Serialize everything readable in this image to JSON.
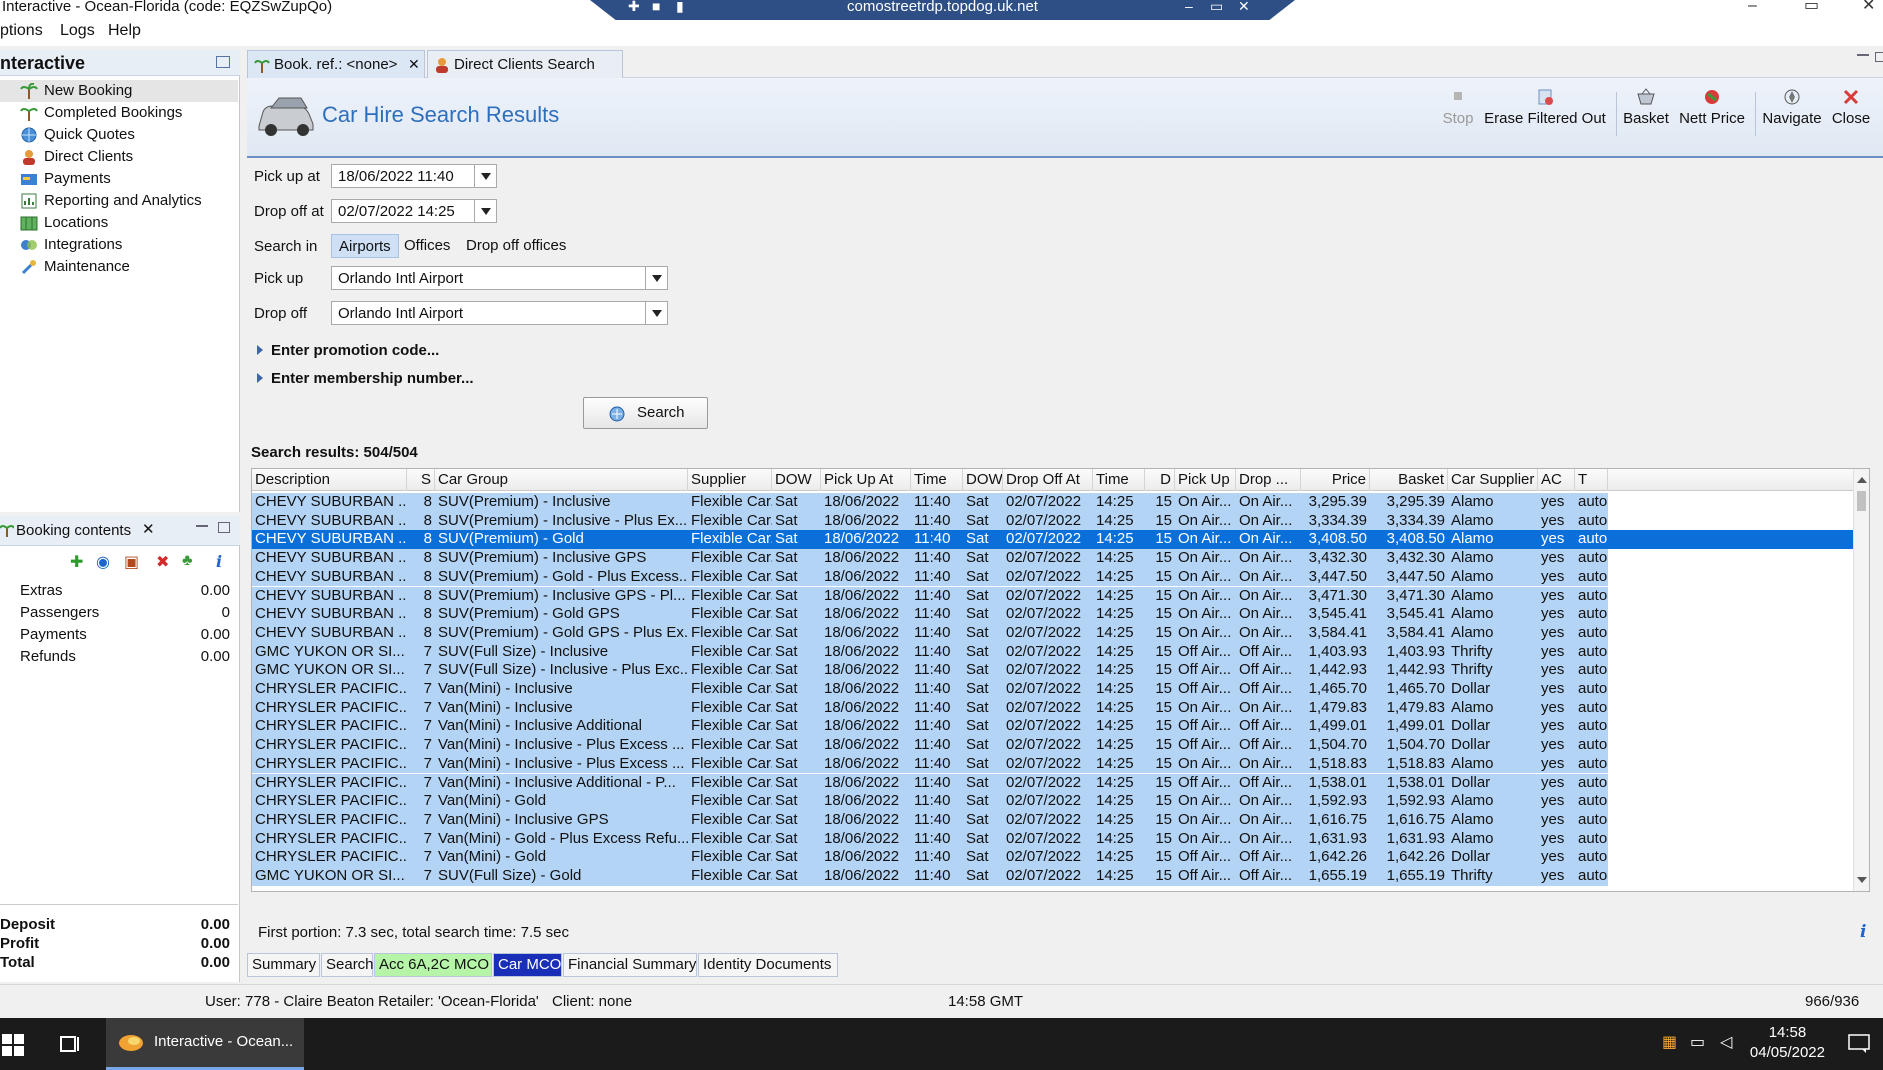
{
  "window": {
    "title": "Interactive - Ocean-Florida (code: EQZSwZupQo)",
    "rdp_host": "comostreetrdp.topdog.uk.net",
    "ctrl_min": "–",
    "ctrl_max": "▭",
    "ctrl_close": "✕"
  },
  "menu": [
    "ptions",
    "Logs",
    "Help"
  ],
  "leftnav": {
    "title": "nteractive",
    "items": [
      {
        "label": "New Booking",
        "icon": "palm-tree-icon"
      },
      {
        "label": "Completed Bookings",
        "icon": "palm-tree-icon"
      },
      {
        "label": "Quick Quotes",
        "icon": "globe-icon"
      },
      {
        "label": "Direct Clients",
        "icon": "person-icon"
      },
      {
        "label": "Payments",
        "icon": "payments-icon"
      },
      {
        "label": "Reporting and Analytics",
        "icon": "report-icon"
      },
      {
        "label": "Locations",
        "icon": "map-icon"
      },
      {
        "label": "Integrations",
        "icon": "integration-icon"
      },
      {
        "label": "Maintenance",
        "icon": "wrench-icon"
      }
    ]
  },
  "booking": {
    "title": "Booking contents",
    "close": "✕",
    "rows": [
      {
        "k": "Extras",
        "v": "0.00"
      },
      {
        "k": "Passengers",
        "v": "0"
      },
      {
        "k": "Payments",
        "v": "0.00"
      },
      {
        "k": "Refunds",
        "v": "0.00"
      }
    ],
    "totals": [
      {
        "k": "Deposit",
        "v": "0.00"
      },
      {
        "k": "Profit",
        "v": "0.00"
      },
      {
        "k": "Total",
        "v": "0.00"
      }
    ]
  },
  "tabs": [
    {
      "label": "Book. ref.: <none>"
    },
    {
      "label": "Direct Clients Search"
    }
  ],
  "tab_close": "✕",
  "header": {
    "title": "Car Hire Search Results",
    "tools": {
      "stop": "Stop",
      "erase": "Erase Filtered Out",
      "basket": "Basket",
      "nett": "Nett Price",
      "navigate": "Navigate",
      "close": "Close"
    }
  },
  "form": {
    "pickup_label": "Pick up at",
    "pickup_value": "18/06/2022 11:40",
    "dropoff_label": "Drop off at",
    "dropoff_value": "02/07/2022 14:25",
    "searchin_label": "Search in",
    "searchin_options": [
      "Airports",
      "Offices",
      "Drop off offices"
    ],
    "pickup_loc_label": "Pick up",
    "pickup_loc_value": "Orlando Intl Airport",
    "dropoff_loc_label": "Drop off",
    "dropoff_loc_value": "Orlando Intl Airport",
    "promo": "Enter promotion code...",
    "membership": "Enter membership number...",
    "search_button": "Search"
  },
  "results": {
    "count": "Search results: 504/504",
    "columns": [
      "Description",
      "S",
      "Car Group",
      "Supplier",
      "DOW",
      "Pick Up At",
      "Time",
      "DOW",
      "Drop Off At",
      "Time",
      "D",
      "Pick Up",
      "Drop ...",
      "Price",
      "Basket",
      "Car Supplier",
      "AC",
      "T"
    ],
    "rows": [
      [
        "CHEVY SUBURBAN ...",
        "8",
        "SUV(Premium) - Inclusive",
        "Flexible Car...",
        "Sat",
        "18/06/2022",
        "11:40",
        "Sat",
        "02/07/2022",
        "14:25",
        "15",
        "On Air...",
        "On Air...",
        "3,295.39",
        "3,295.39",
        "Alamo",
        "yes",
        "auto"
      ],
      [
        "CHEVY SUBURBAN ...",
        "8",
        "SUV(Premium) - Inclusive - Plus Ex...",
        "Flexible Car...",
        "Sat",
        "18/06/2022",
        "11:40",
        "Sat",
        "02/07/2022",
        "14:25",
        "15",
        "On Air...",
        "On Air...",
        "3,334.39",
        "3,334.39",
        "Alamo",
        "yes",
        "auto"
      ],
      [
        "CHEVY SUBURBAN ...",
        "8",
        "SUV(Premium) - Gold",
        "Flexible Car...",
        "Sat",
        "18/06/2022",
        "11:40",
        "Sat",
        "02/07/2022",
        "14:25",
        "15",
        "On Air...",
        "On Air...",
        "3,408.50",
        "3,408.50",
        "Alamo",
        "yes",
        "auto"
      ],
      [
        "CHEVY SUBURBAN ...",
        "8",
        "SUV(Premium) - Inclusive GPS",
        "Flexible Car...",
        "Sat",
        "18/06/2022",
        "11:40",
        "Sat",
        "02/07/2022",
        "14:25",
        "15",
        "On Air...",
        "On Air...",
        "3,432.30",
        "3,432.30",
        "Alamo",
        "yes",
        "auto"
      ],
      [
        "CHEVY SUBURBAN ...",
        "8",
        "SUV(Premium) - Gold - Plus Excess...",
        "Flexible Car...",
        "Sat",
        "18/06/2022",
        "11:40",
        "Sat",
        "02/07/2022",
        "14:25",
        "15",
        "On Air...",
        "On Air...",
        "3,447.50",
        "3,447.50",
        "Alamo",
        "yes",
        "auto"
      ],
      [
        "CHEVY SUBURBAN ...",
        "8",
        "SUV(Premium) - Inclusive GPS - Pl...",
        "Flexible Car...",
        "Sat",
        "18/06/2022",
        "11:40",
        "Sat",
        "02/07/2022",
        "14:25",
        "15",
        "On Air...",
        "On Air...",
        "3,471.30",
        "3,471.30",
        "Alamo",
        "yes",
        "auto"
      ],
      [
        "CHEVY SUBURBAN ...",
        "8",
        "SUV(Premium) - Gold GPS",
        "Flexible Car...",
        "Sat",
        "18/06/2022",
        "11:40",
        "Sat",
        "02/07/2022",
        "14:25",
        "15",
        "On Air...",
        "On Air...",
        "3,545.41",
        "3,545.41",
        "Alamo",
        "yes",
        "auto"
      ],
      [
        "CHEVY SUBURBAN ...",
        "8",
        "SUV(Premium) - Gold GPS - Plus Ex...",
        "Flexible Car...",
        "Sat",
        "18/06/2022",
        "11:40",
        "Sat",
        "02/07/2022",
        "14:25",
        "15",
        "On Air...",
        "On Air...",
        "3,584.41",
        "3,584.41",
        "Alamo",
        "yes",
        "auto"
      ],
      [
        "GMC YUKON OR SI...",
        "7",
        "SUV(Full Size) - Inclusive",
        "Flexible Car...",
        "Sat",
        "18/06/2022",
        "11:40",
        "Sat",
        "02/07/2022",
        "14:25",
        "15",
        "Off Air...",
        "Off Air...",
        "1,403.93",
        "1,403.93",
        "Thrifty",
        "yes",
        "auto"
      ],
      [
        "GMC YUKON OR SI...",
        "7",
        "SUV(Full Size) - Inclusive - Plus Exc...",
        "Flexible Car...",
        "Sat",
        "18/06/2022",
        "11:40",
        "Sat",
        "02/07/2022",
        "14:25",
        "15",
        "Off Air...",
        "Off Air...",
        "1,442.93",
        "1,442.93",
        "Thrifty",
        "yes",
        "auto"
      ],
      [
        "CHRYSLER PACIFIC...",
        "7",
        "Van(Mini) - Inclusive",
        "Flexible Car...",
        "Sat",
        "18/06/2022",
        "11:40",
        "Sat",
        "02/07/2022",
        "14:25",
        "15",
        "Off Air...",
        "Off Air...",
        "1,465.70",
        "1,465.70",
        "Dollar",
        "yes",
        "auto"
      ],
      [
        "CHRYSLER PACIFIC...",
        "7",
        "Van(Mini) - Inclusive",
        "Flexible Car...",
        "Sat",
        "18/06/2022",
        "11:40",
        "Sat",
        "02/07/2022",
        "14:25",
        "15",
        "On Air...",
        "On Air...",
        "1,479.83",
        "1,479.83",
        "Alamo",
        "yes",
        "auto"
      ],
      [
        "CHRYSLER PACIFIC...",
        "7",
        "Van(Mini) - Inclusive Additional",
        "Flexible Car...",
        "Sat",
        "18/06/2022",
        "11:40",
        "Sat",
        "02/07/2022",
        "14:25",
        "15",
        "Off Air...",
        "Off Air...",
        "1,499.01",
        "1,499.01",
        "Dollar",
        "yes",
        "auto"
      ],
      [
        "CHRYSLER PACIFIC...",
        "7",
        "Van(Mini) - Inclusive - Plus Excess ...",
        "Flexible Car...",
        "Sat",
        "18/06/2022",
        "11:40",
        "Sat",
        "02/07/2022",
        "14:25",
        "15",
        "Off Air...",
        "Off Air...",
        "1,504.70",
        "1,504.70",
        "Dollar",
        "yes",
        "auto"
      ],
      [
        "CHRYSLER PACIFIC...",
        "7",
        "Van(Mini) - Inclusive - Plus Excess ...",
        "Flexible Car...",
        "Sat",
        "18/06/2022",
        "11:40",
        "Sat",
        "02/07/2022",
        "14:25",
        "15",
        "On Air...",
        "On Air...",
        "1,518.83",
        "1,518.83",
        "Alamo",
        "yes",
        "auto"
      ],
      [
        "CHRYSLER PACIFIC...",
        "7",
        "Van(Mini) - Inclusive Additional - P...",
        "Flexible Car...",
        "Sat",
        "18/06/2022",
        "11:40",
        "Sat",
        "02/07/2022",
        "14:25",
        "15",
        "Off Air...",
        "Off Air...",
        "1,538.01",
        "1,538.01",
        "Dollar",
        "yes",
        "auto"
      ],
      [
        "CHRYSLER PACIFIC...",
        "7",
        "Van(Mini) - Gold",
        "Flexible Car...",
        "Sat",
        "18/06/2022",
        "11:40",
        "Sat",
        "02/07/2022",
        "14:25",
        "15",
        "On Air...",
        "On Air...",
        "1,592.93",
        "1,592.93",
        "Alamo",
        "yes",
        "auto"
      ],
      [
        "CHRYSLER PACIFIC...",
        "7",
        "Van(Mini) - Inclusive GPS",
        "Flexible Car...",
        "Sat",
        "18/06/2022",
        "11:40",
        "Sat",
        "02/07/2022",
        "14:25",
        "15",
        "On Air...",
        "On Air...",
        "1,616.75",
        "1,616.75",
        "Alamo",
        "yes",
        "auto"
      ],
      [
        "CHRYSLER PACIFIC...",
        "7",
        "Van(Mini) - Gold - Plus Excess Refu...",
        "Flexible Car...",
        "Sat",
        "18/06/2022",
        "11:40",
        "Sat",
        "02/07/2022",
        "14:25",
        "15",
        "On Air...",
        "On Air...",
        "1,631.93",
        "1,631.93",
        "Alamo",
        "yes",
        "auto"
      ],
      [
        "CHRYSLER PACIFIC...",
        "7",
        "Van(Mini) - Gold",
        "Flexible Car...",
        "Sat",
        "18/06/2022",
        "11:40",
        "Sat",
        "02/07/2022",
        "14:25",
        "15",
        "Off Air...",
        "Off Air...",
        "1,642.26",
        "1,642.26",
        "Dollar",
        "yes",
        "auto"
      ],
      [
        "GMC YUKON OR SI...",
        "7",
        "SUV(Full Size) - Gold",
        "Flexible Car...",
        "Sat",
        "18/06/2022",
        "11:40",
        "Sat",
        "02/07/2022",
        "14:25",
        "15",
        "Off Air...",
        "Off Air...",
        "1,655.19",
        "1,655.19",
        "Thrifty",
        "yes",
        "auto"
      ]
    ],
    "selected_row": 2
  },
  "timing": "First portion: 7.3 sec, total search time: 7.5 sec",
  "info_glyph": "i",
  "bottom_tabs": [
    "Summary",
    "Search",
    "Acc 6A,2C MCO",
    "Car MCO",
    "Financial Summary",
    "Identity Documents"
  ],
  "status": {
    "user": "User: 778 - Claire Beaton",
    "retailer": "Retailer: 'Ocean-Florida'",
    "client": "Client: none",
    "time": "14:58 GMT",
    "counter": "966/936"
  },
  "taskbar": {
    "app_label": "Interactive - Ocean...",
    "clock_time": "14:58",
    "clock_date": "04/05/2022"
  },
  "colors": {
    "accent": "#2e6fbd",
    "selected_row": "#0a6fd8",
    "row_bg": "#b4d4f6",
    "green_tab": "#b6f5a8",
    "blue_tab": "#1a2fb8"
  }
}
